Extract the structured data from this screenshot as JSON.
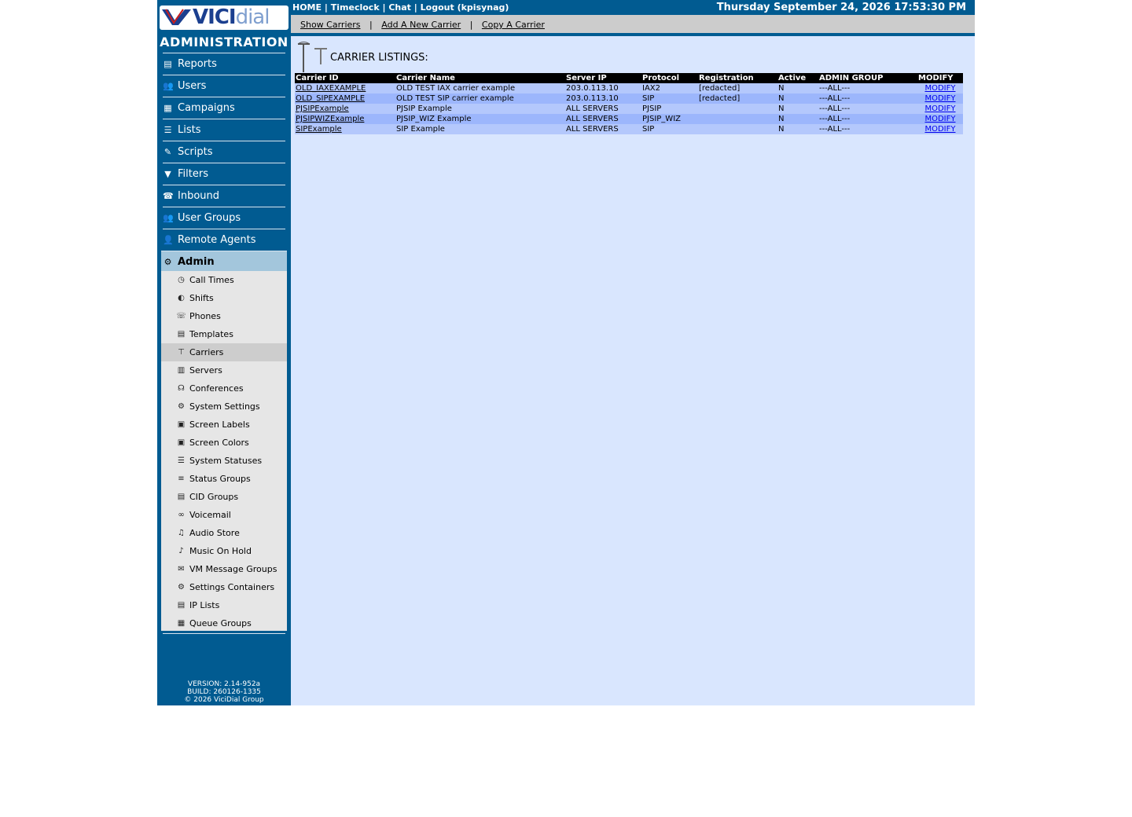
{
  "brand": {
    "logo_vici": "VICI",
    "logo_dial": "dial",
    "admin_title": "ADMINISTRATION"
  },
  "nav": [
    {
      "label": "Reports",
      "icon": "reports-icon",
      "glyph": "▤"
    },
    {
      "label": "Users",
      "icon": "users-icon",
      "glyph": "👥"
    },
    {
      "label": "Campaigns",
      "icon": "campaigns-icon",
      "glyph": "▦"
    },
    {
      "label": "Lists",
      "icon": "lists-icon",
      "glyph": "☰"
    },
    {
      "label": "Scripts",
      "icon": "scripts-icon",
      "glyph": "✎"
    },
    {
      "label": "Filters",
      "icon": "filters-icon",
      "glyph": "▼"
    },
    {
      "label": "Inbound",
      "icon": "inbound-icon",
      "glyph": "☎"
    },
    {
      "label": "User Groups",
      "icon": "user-groups-icon",
      "glyph": "👥"
    },
    {
      "label": "Remote Agents",
      "icon": "remote-agents-icon",
      "glyph": "👤"
    },
    {
      "label": "Admin",
      "icon": "gear-icon",
      "glyph": "⚙"
    }
  ],
  "submenu": [
    {
      "label": "Call Times",
      "icon": "clock-phone-icon",
      "glyph": "◷"
    },
    {
      "label": "Shifts",
      "icon": "shifts-icon",
      "glyph": "◐"
    },
    {
      "label": "Phones",
      "icon": "phones-icon",
      "glyph": "☏"
    },
    {
      "label": "Templates",
      "icon": "templates-icon",
      "glyph": "▤"
    },
    {
      "label": "Carriers",
      "icon": "carriers-icon",
      "glyph": "⊤"
    },
    {
      "label": "Servers",
      "icon": "servers-icon",
      "glyph": "▥"
    },
    {
      "label": "Conferences",
      "icon": "conferences-icon",
      "glyph": "☊"
    },
    {
      "label": "System Settings",
      "icon": "system-settings-icon",
      "glyph": "⚙"
    },
    {
      "label": "Screen Labels",
      "icon": "screen-labels-icon",
      "glyph": "▣"
    },
    {
      "label": "Screen Colors",
      "icon": "screen-colors-icon",
      "glyph": "▣"
    },
    {
      "label": "System Statuses",
      "icon": "system-statuses-icon",
      "glyph": "☰"
    },
    {
      "label": "Status Groups",
      "icon": "status-groups-icon",
      "glyph": "≡"
    },
    {
      "label": "CID Groups",
      "icon": "cid-groups-icon",
      "glyph": "▤"
    },
    {
      "label": "Voicemail",
      "icon": "voicemail-icon",
      "glyph": "∞"
    },
    {
      "label": "Audio Store",
      "icon": "audio-store-icon",
      "glyph": "♫"
    },
    {
      "label": "Music On Hold",
      "icon": "music-on-hold-icon",
      "glyph": "♪"
    },
    {
      "label": "VM Message Groups",
      "icon": "vm-message-groups-icon",
      "glyph": "✉"
    },
    {
      "label": "Settings Containers",
      "icon": "settings-containers-icon",
      "glyph": "⚙"
    },
    {
      "label": "IP Lists",
      "icon": "ip-lists-icon",
      "glyph": "▤"
    },
    {
      "label": "Queue Groups",
      "icon": "queue-groups-icon",
      "glyph": "▦"
    }
  ],
  "version": {
    "version": "VERSION: 2.14-952a",
    "build": "BUILD: 260126-1335",
    "copyright": "© 2026 ViciDial Group"
  },
  "topbar": {
    "home": "HOME",
    "timeclock": "Timeclock",
    "chat": "Chat",
    "logout": "Logout (kpisynag)",
    "sep": "|",
    "datetime": "Thursday September 24, 2026 17:53:30 PM"
  },
  "subbar": {
    "show": "Show Carriers",
    "add": "Add A New Carrier",
    "copy": "Copy A Carrier",
    "sep": "|"
  },
  "listing": {
    "title": "CARRIER LISTINGS:",
    "columns": [
      "Carrier ID",
      "Carrier Name",
      "Server IP",
      "Protocol",
      "Registration",
      "Active",
      "ADMIN GROUP",
      "MODIFY"
    ],
    "rows": [
      {
        "id": "OLD_IAXEXAMPLE",
        "name": "OLD TEST IAX carrier example",
        "server_ip": "203.0.113.10",
        "protocol": "IAX2",
        "registration": "[redacted]",
        "active": "N",
        "admin_group": "---ALL---",
        "modify": "MODIFY"
      },
      {
        "id": "OLD_SIPEXAMPLE",
        "name": "OLD TEST SIP carrier example",
        "server_ip": "203.0.113.10",
        "protocol": "SIP",
        "registration": "[redacted]",
        "active": "N",
        "admin_group": "---ALL---",
        "modify": "MODIFY"
      },
      {
        "id": "PJSIPExample",
        "name": "PJSIP Example",
        "server_ip": "ALL SERVERS",
        "protocol": "PJSIP",
        "registration": "",
        "active": "N",
        "admin_group": "---ALL---",
        "modify": "MODIFY"
      },
      {
        "id": "PJSIPWIZExample",
        "name": "PJSIP_WIZ Example",
        "server_ip": "ALL SERVERS",
        "protocol": "PJSIP_WIZ",
        "registration": "",
        "active": "N",
        "admin_group": "---ALL---",
        "modify": "MODIFY"
      },
      {
        "id": "SIPExample",
        "name": "SIP Example",
        "server_ip": "ALL SERVERS",
        "protocol": "SIP",
        "registration": "",
        "active": "N",
        "admin_group": "---ALL---",
        "modify": "MODIFY"
      }
    ]
  },
  "colors": {
    "sidebar_bg": "#015b91",
    "active_nav_bg": "#a3c6dc",
    "main_bg": "#d9e6fe",
    "row_a": "#b4c8fc",
    "row_b": "#9cb6fc",
    "subbar_bg": "#cccccc",
    "submenu_bg": "#e6e6e6"
  }
}
